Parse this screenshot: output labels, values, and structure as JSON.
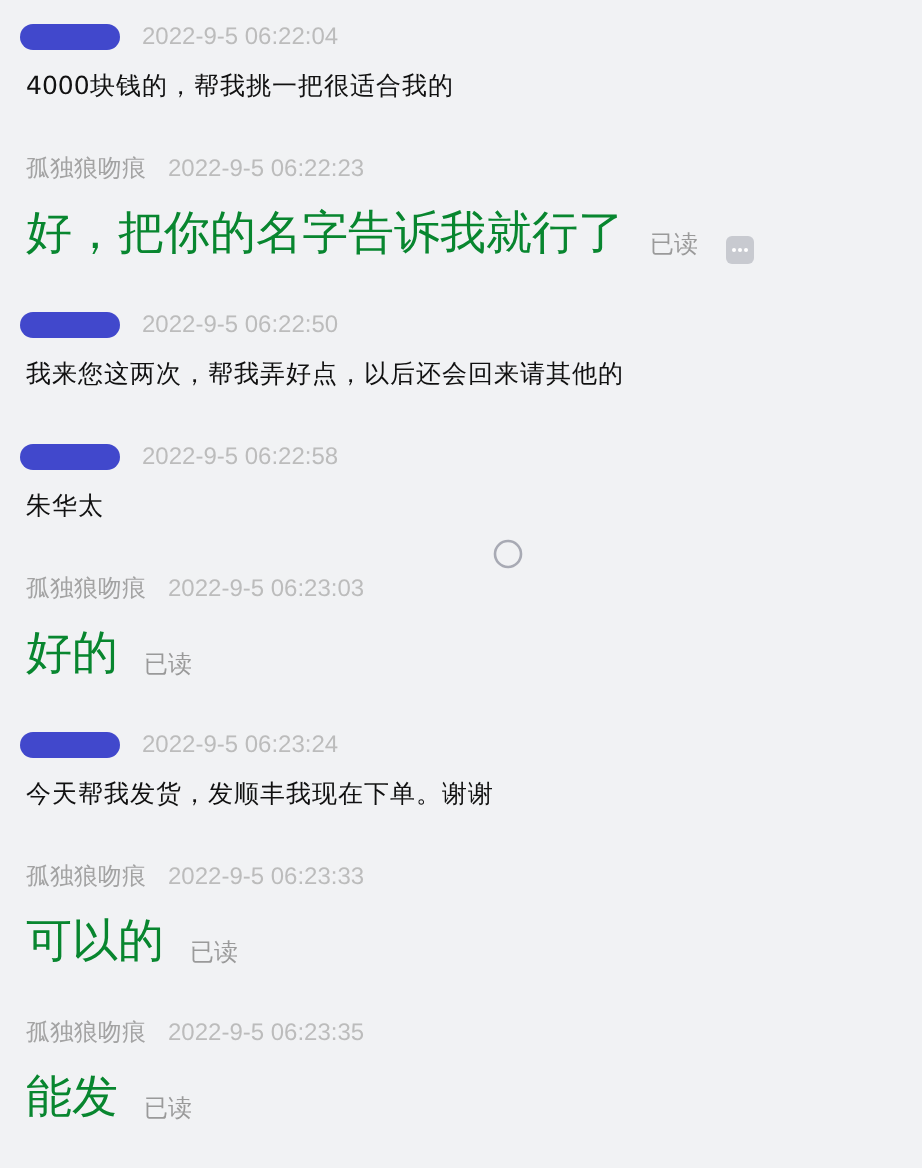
{
  "messages": [
    {
      "kind": "customer",
      "time": "2022-9-5 06:22:04",
      "text": "4000块钱的，帮我挑一把很适合我的"
    },
    {
      "kind": "seller",
      "name": "孤独狼吻痕",
      "time": "2022-9-5 06:22:23",
      "text": "好，把你的名字告诉我就行了",
      "receipt": "已读",
      "more_button": true
    },
    {
      "kind": "customer",
      "time": "2022-9-5 06:22:50",
      "text": "我来您这两次，帮我弄好点，以后还会回来请其他的"
    },
    {
      "kind": "customer",
      "time": "2022-9-5 06:22:58",
      "text": "朱华太"
    },
    {
      "kind": "seller",
      "name": "孤独狼吻痕",
      "time": "2022-9-5 06:23:03",
      "text": "好的",
      "receipt": "已读",
      "more_button": false
    },
    {
      "kind": "customer",
      "time": "2022-9-5 06:23:24",
      "text": "今天帮我发货，发顺丰我现在下单。谢谢"
    },
    {
      "kind": "seller",
      "name": "孤独狼吻痕",
      "time": "2022-9-5 06:23:33",
      "text": "可以的",
      "receipt": "已读",
      "more_button": false
    },
    {
      "kind": "seller",
      "name": "孤独狼吻痕",
      "time": "2022-9-5 06:23:35",
      "text": "能发",
      "receipt": "已读",
      "more_button": false
    }
  ]
}
